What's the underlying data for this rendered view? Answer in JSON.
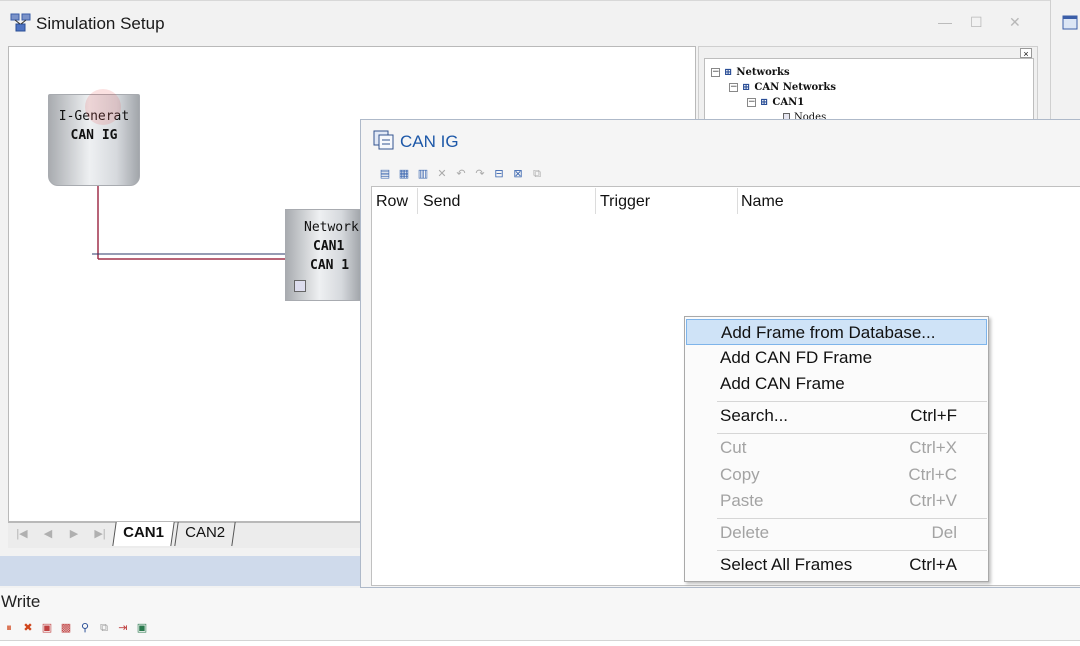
{
  "sim_setup": {
    "title": "Simulation Setup",
    "title_icon": "network-icon",
    "window_controls": {
      "minimize": "—",
      "maximize": "☐",
      "close": "✕"
    },
    "ig_node": {
      "line1": "I-Generat",
      "line2": "CAN IG"
    },
    "network_node": {
      "line1": "Network",
      "line2": "CAN1",
      "line3": "CAN 1"
    },
    "tree": [
      {
        "label": "Networks",
        "expander": "−"
      },
      {
        "label": "CAN Networks",
        "expander": "−"
      },
      {
        "label": "CAN1",
        "expander": "−"
      },
      {
        "label": "Nodes",
        "expander": ""
      }
    ],
    "tabs": [
      {
        "label": "CAN1",
        "active": true
      },
      {
        "label": "CAN2",
        "active": false
      }
    ],
    "nav_buttons": [
      "|◀",
      "◀",
      "▶",
      "▶|"
    ]
  },
  "can_ig": {
    "title": "CAN IG",
    "toolbar_icons": [
      "add-frame-icon",
      "add-fd-frame-icon",
      "add-db-frame-icon",
      "delete-icon",
      "undo-icon",
      "redo-icon",
      "import-icon",
      "export-icon",
      "settings-icon"
    ],
    "columns": [
      "Row",
      "Send",
      "Trigger",
      "Name"
    ]
  },
  "context_menu": {
    "items": [
      {
        "label": "Add Frame from Database...",
        "shortcut": "",
        "disabled": false,
        "highlighted": true
      },
      {
        "label": "Add CAN FD Frame",
        "shortcut": "",
        "disabled": false,
        "highlighted": false
      },
      {
        "label": "Add CAN Frame",
        "shortcut": "",
        "disabled": false,
        "highlighted": false
      },
      {
        "label": "Search...",
        "shortcut": "Ctrl+F",
        "disabled": false,
        "highlighted": false
      },
      {
        "label": "Cut",
        "shortcut": "Ctrl+X",
        "disabled": true,
        "highlighted": false
      },
      {
        "label": "Copy",
        "shortcut": "Ctrl+C",
        "disabled": true,
        "highlighted": false
      },
      {
        "label": "Paste",
        "shortcut": "Ctrl+V",
        "disabled": true,
        "highlighted": false
      },
      {
        "label": "Delete",
        "shortcut": "Del",
        "disabled": true,
        "highlighted": false
      },
      {
        "label": "Select All Frames",
        "shortcut": "Ctrl+A",
        "disabled": false,
        "highlighted": false
      }
    ]
  },
  "write_panel": {
    "label": "Write",
    "toolbar_icons": [
      "pause-icon",
      "clear-icon",
      "filter-icon",
      "options-icon",
      "find-icon",
      "copy-icon",
      "export-icon",
      "window-icon"
    ]
  },
  "colors": {
    "connection_line": "#a0304a",
    "accent_blue": "#1d58a8",
    "menu_highlight": "#cfe3f7"
  }
}
